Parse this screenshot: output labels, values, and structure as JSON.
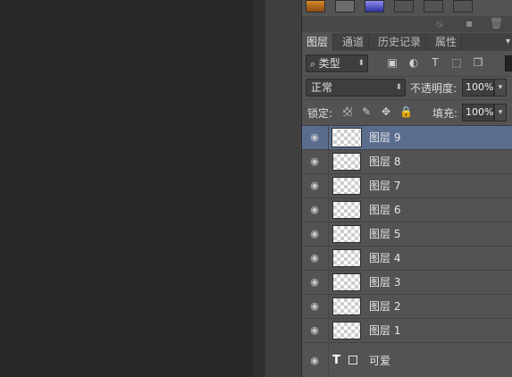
{
  "panel": {
    "tabs": [
      {
        "label": "图层",
        "active": true
      },
      {
        "label": "通道",
        "active": false
      },
      {
        "label": "历史记录",
        "active": false
      },
      {
        "label": "属性",
        "active": false
      }
    ],
    "filter": {
      "label": "类型"
    },
    "blend_mode": "正常",
    "opacity_label": "不透明度:",
    "opacity_value": "100%",
    "lock_label": "锁定:",
    "fill_label": "填充:",
    "fill_value": "100%"
  },
  "layers": [
    {
      "name": "图层 9",
      "selected": true
    },
    {
      "name": "图层 8"
    },
    {
      "name": "图层 7"
    },
    {
      "name": "图层 6"
    },
    {
      "name": "图层 5"
    },
    {
      "name": "图层 4"
    },
    {
      "name": "图层 3"
    },
    {
      "name": "图层 2"
    },
    {
      "name": "图层 1"
    },
    {
      "name": "可爱",
      "type": "text"
    }
  ],
  "colors": {
    "canvas_bg": "#282828",
    "panel_bg": "#535353",
    "selected_row": "#5a6d8f"
  }
}
